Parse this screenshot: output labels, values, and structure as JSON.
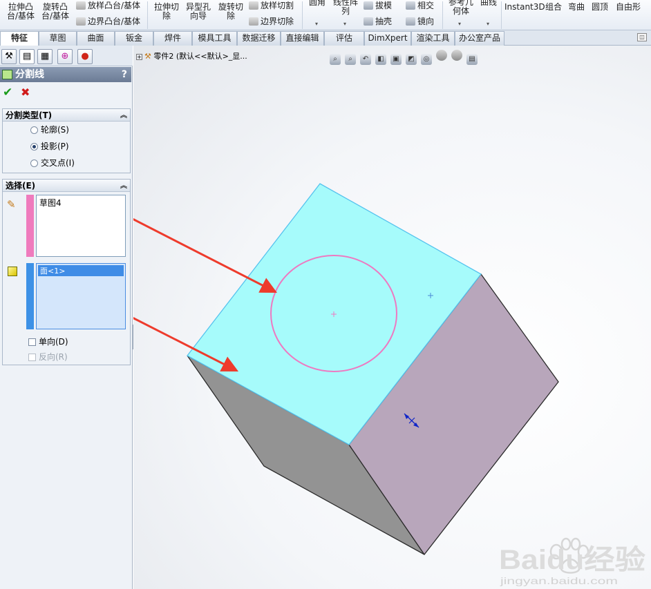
{
  "ribbon": {
    "extrude_boss": "拉伸凸\n台/基体",
    "revolve_boss": "旋转凸\n台/基体",
    "loft_boss": "放样凸台/基体",
    "boundary_boss": "边界凸台/基体",
    "extrude_cut": "拉伸切\n除",
    "hole_wizard": "异型孔\n向导",
    "revolve_cut": "旋转切\n除",
    "loft_cut": "放样切割",
    "boundary_cut": "边界切除",
    "fillet": "圆角",
    "linear_pattern": "线性阵\n列",
    "draft": "拔模",
    "shell": "抽壳",
    "intersect": "相交",
    "mirror": "镜向",
    "ref_geometry": "参考几\n何体",
    "curves": "曲线",
    "instant3d": "Instant3D",
    "combine": "组合",
    "flex": "弯曲",
    "dome": "圆顶",
    "freeform": "自由形"
  },
  "tabs": [
    "特征",
    "草图",
    "曲面",
    "钣金",
    "焊件",
    "模具工具",
    "数据迁移",
    "直接编辑",
    "评估",
    "DimXpert",
    "渲染工具",
    "办公室产品"
  ],
  "property_manager": {
    "title": "分割线",
    "help": "?",
    "ok": "✔",
    "cancel": "✖",
    "split_type": {
      "header": "分割类型(T)",
      "options": [
        "轮廓(S)",
        "投影(P)",
        "交叉点(I)"
      ],
      "selected": "投影(P)"
    },
    "selections": {
      "header": "选择(E)",
      "sketch_item": "草图4",
      "face_item": "面<1>",
      "single_direction": "单向(D)",
      "reverse_direction": "反向(R)"
    }
  },
  "feature_tree": {
    "part_label": "零件2 (默认<<默认>_显..."
  },
  "watermark": {
    "brand": "Baidu经验",
    "url": "jingyan.baidu.com"
  },
  "colors": {
    "top_face": "#a6fbfb",
    "right_face": "#b8a6bb",
    "left_face": "#939393",
    "sketch_circle": "#ee79c1",
    "arrow": "#ee3b2c",
    "sketch_bar": "#ef7bbd",
    "face_bar": "#3d91e6"
  }
}
